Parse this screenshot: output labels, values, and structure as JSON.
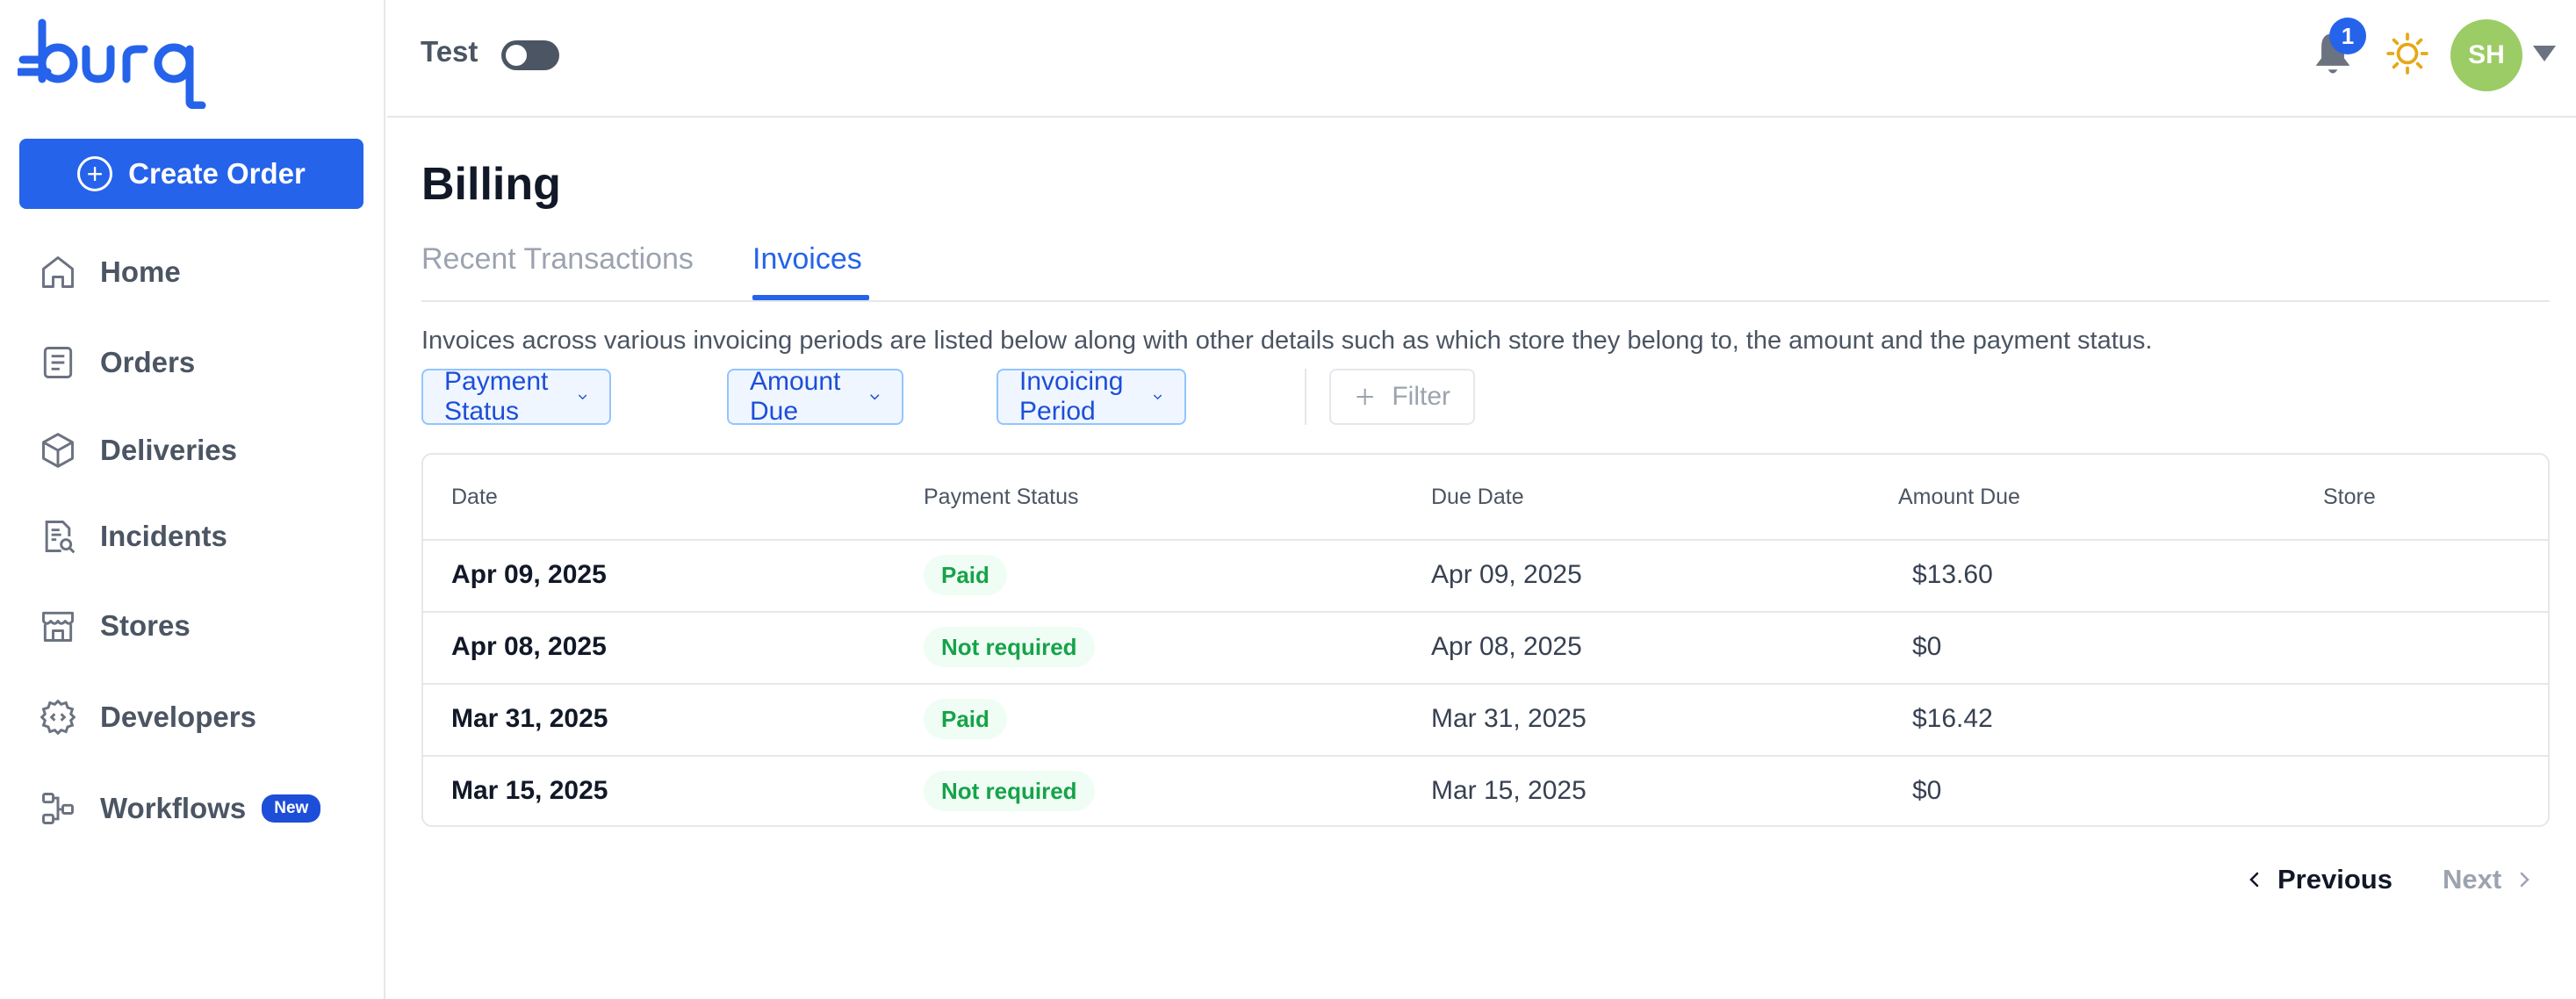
{
  "app": {
    "logo_text": "burq",
    "colors": {
      "accent": "#2563eb",
      "paid_badge": "#16a34a",
      "avatar": "#9ccc65"
    }
  },
  "sidebar": {
    "create_label": "Create Order",
    "items": [
      {
        "label": "Home",
        "icon": "home-icon"
      },
      {
        "label": "Orders",
        "icon": "orders-icon"
      },
      {
        "label": "Deliveries",
        "icon": "box-icon"
      },
      {
        "label": "Incidents",
        "icon": "incident-report-icon"
      },
      {
        "label": "Stores",
        "icon": "store-icon"
      },
      {
        "label": "Developers",
        "icon": "code-gear-icon"
      },
      {
        "label": "Workflows",
        "icon": "workflow-icon",
        "badge": "New"
      }
    ]
  },
  "topbar": {
    "test_label": "Test",
    "test_mode_on": false,
    "notification_count": "1",
    "avatar_initials": "SH"
  },
  "main": {
    "title": "Billing",
    "tabs": [
      {
        "label": "Recent Transactions",
        "active": false
      },
      {
        "label": "Invoices",
        "active": true
      }
    ],
    "description": "Invoices across various invoicing periods are listed below along with other details such as which store they belong to, the amount and the payment status.",
    "filters": [
      "Payment Status",
      "Amount Due",
      "Invoicing Period"
    ],
    "filter_button": "Filter",
    "table": {
      "columns": [
        "Date",
        "Payment Status",
        "Due Date",
        "Amount Due",
        "Store"
      ],
      "rows": [
        {
          "date": "Apr 09, 2025",
          "status": "Paid",
          "due_date": "Apr 09, 2025",
          "amount": "$13.60",
          "store": ""
        },
        {
          "date": "Apr 08, 2025",
          "status": "Not required",
          "due_date": "Apr 08, 2025",
          "amount": "$0",
          "store": ""
        },
        {
          "date": "Mar 31, 2025",
          "status": "Paid",
          "due_date": "Mar 31, 2025",
          "amount": "$16.42",
          "store": ""
        },
        {
          "date": "Mar 15, 2025",
          "status": "Not required",
          "due_date": "Mar 15, 2025",
          "amount": "$0",
          "store": ""
        }
      ]
    },
    "pagination": {
      "previous": "Previous",
      "next": "Next"
    }
  }
}
